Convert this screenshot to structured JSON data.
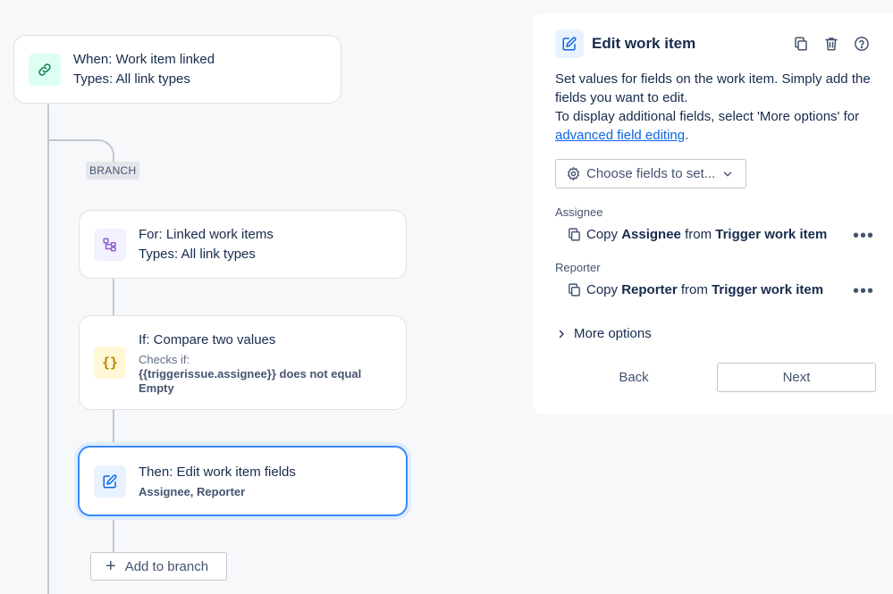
{
  "flow": {
    "trigger": {
      "title": "When: Work item linked",
      "subtitle": "Types: All link types",
      "icon": "link-icon",
      "icon_bg": "#dcfff1",
      "icon_color": "#1f845a"
    },
    "branch_label": "BRANCH",
    "branch": {
      "title": "For: Linked work items",
      "subtitle": "Types: All link types",
      "icon": "branch-icon",
      "icon_bg": "#f3f0ff",
      "icon_color": "#8f5ec8"
    },
    "condition": {
      "title": "If: Compare two values",
      "checks_label": "Checks if:",
      "checks_line1": "{{triggerissue.assignee}} does not equal",
      "checks_line2": "Empty",
      "icon": "braces-icon",
      "icon_bg": "#fff7d6",
      "icon_color": "#b38600"
    },
    "action": {
      "title": "Then: Edit work item fields",
      "subtitle": "Assignee, Reporter",
      "icon": "edit-icon",
      "icon_bg": "#e9f2ff",
      "icon_color": "#0c66e4"
    },
    "add_branch": "Add to branch"
  },
  "panel": {
    "title": "Edit work item",
    "description_1": "Set values for fields on the work item. Simply add the fields you want to edit.",
    "description_2": "To display additional fields, select 'More options' for",
    "description_link": "advanced field editing",
    "description_end": ".",
    "choose_fields": "Choose fields to set...",
    "fields": [
      {
        "label": "Assignee",
        "copy": "Copy",
        "field": "Assignee",
        "from": "from",
        "source": "Trigger work item"
      },
      {
        "label": "Reporter",
        "copy": "Copy",
        "field": "Reporter",
        "from": "from",
        "source": "Trigger work item"
      }
    ],
    "more_options": "More options",
    "back": "Back",
    "next": "Next"
  }
}
